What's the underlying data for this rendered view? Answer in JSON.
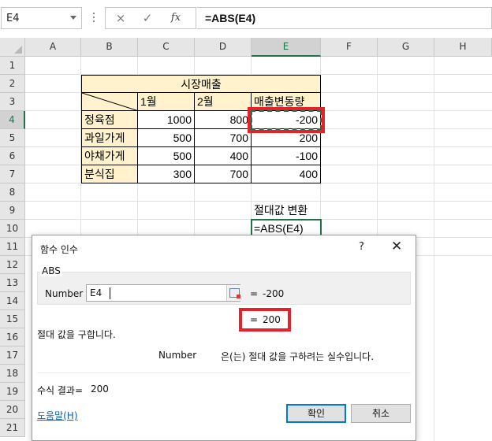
{
  "formula_bar": {
    "name_box": "E4",
    "cancel_icon": "×",
    "enter_icon": "✓",
    "fx_label": "fx",
    "formula": "=ABS(E4)"
  },
  "sheet": {
    "columns": [
      "A",
      "B",
      "C",
      "D",
      "E",
      "F",
      "G",
      "H"
    ],
    "rows": [
      "1",
      "2",
      "3",
      "4",
      "5",
      "6",
      "7",
      "8",
      "9",
      "10",
      "11",
      "12",
      "13",
      "14",
      "15",
      "16",
      "17",
      "18",
      "19",
      "20",
      "21"
    ],
    "selected_column": "E",
    "selected_row": "4",
    "table": {
      "title": "시장매출",
      "header": [
        "1월",
        "2월",
        "매출변동량"
      ],
      "rows": [
        {
          "name": "정육점",
          "m1": "1000",
          "m2": "800",
          "change": "-200"
        },
        {
          "name": "과일가게",
          "m1": "500",
          "m2": "700",
          "change": "200"
        },
        {
          "name": "야채가게",
          "m1": "500",
          "m2": "400",
          "change": "-100"
        },
        {
          "name": "분식집",
          "m1": "300",
          "m2": "700",
          "change": "400"
        }
      ]
    },
    "e9": "절대값 변환",
    "e10": "=ABS(E4)"
  },
  "dialog": {
    "title": "함수 인수",
    "help_icon": "?",
    "close_icon": "✕",
    "function_name": "ABS",
    "arg_label": "Number",
    "arg_value": "E4",
    "arg_equals": "=",
    "arg_result": "-200",
    "result_equals": "=",
    "result_value": "200",
    "description": "절대 값을 구합니다.",
    "arg_desc_label": "Number",
    "arg_desc": "은(는) 절대 값을 구하려는 실수입니다.",
    "formula_result_label": "수식 결과=",
    "formula_result_value": "200",
    "help_link": "도움말(H)",
    "ok_button": "확인",
    "cancel_button": "취소"
  },
  "colors": {
    "accent": "#217346",
    "highlight_red": "#e5212b",
    "table_fill": "#fff2cc"
  }
}
